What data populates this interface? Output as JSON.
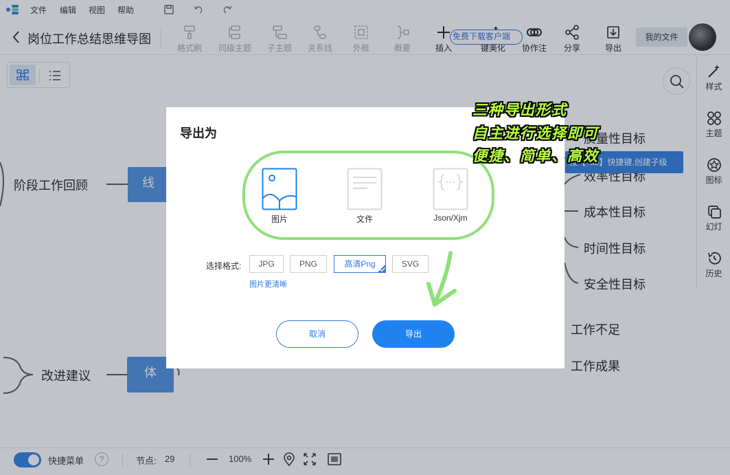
{
  "menu": {
    "file": "文件",
    "edit": "编辑",
    "view": "视图",
    "help": "帮助"
  },
  "toolbar": {
    "title": "岗位工作总结思维导图",
    "format_brush": "格式刷",
    "sibling": "同级主题",
    "child": "子主题",
    "relation": "关系线",
    "frame": "外框",
    "summary": "概要",
    "insert": "插入",
    "beautify": "键美化",
    "collab": "协作注",
    "share": "分享",
    "export": "导出",
    "download_client": "免费下载客户端",
    "my_files": "我的文件"
  },
  "side_panel": {
    "style": "样式",
    "theme": "主题",
    "icon": "图标",
    "slides": "幻灯",
    "history": "历史"
  },
  "canvas": {
    "node_review": "阶段工作回顾",
    "node_line": "线",
    "node_improve": "改进建议",
    "node_body": "体",
    "node_quality": "质量性目标",
    "node_efficiency": "效率性目标",
    "node_cost": "成本性目标",
    "node_time": "时间性目标",
    "node_safety": "安全性目标",
    "node_shortfall": "工作不足",
    "node_results": "工作成果",
    "tab_hint": "按【Tab】快捷键,创建子级"
  },
  "dialog": {
    "title": "导出为",
    "type_image": "图片",
    "type_file": "文件",
    "type_json": "Json/Xjm",
    "format_label": "选择格式:",
    "formats": [
      "JPG",
      "PNG",
      "高清Png",
      "SVG"
    ],
    "selected_format": "高清Png",
    "hint": "图片更清晰",
    "cancel": "取消",
    "confirm": "导出"
  },
  "annotation": {
    "line1": "三种导出形式",
    "line2": "自主进行选择即可",
    "line3": "便捷、简单、高效"
  },
  "statusbar": {
    "quick_menu": "快捷菜单",
    "help": "?",
    "nodes_label": "节点:",
    "nodes_count": "29",
    "zoom": "100%"
  },
  "colors": {
    "accent": "#1e83f0",
    "node_fill": "#4d8fe3",
    "annotation_green": "#8ee07a",
    "annotation_text": "#b8ff3a"
  }
}
